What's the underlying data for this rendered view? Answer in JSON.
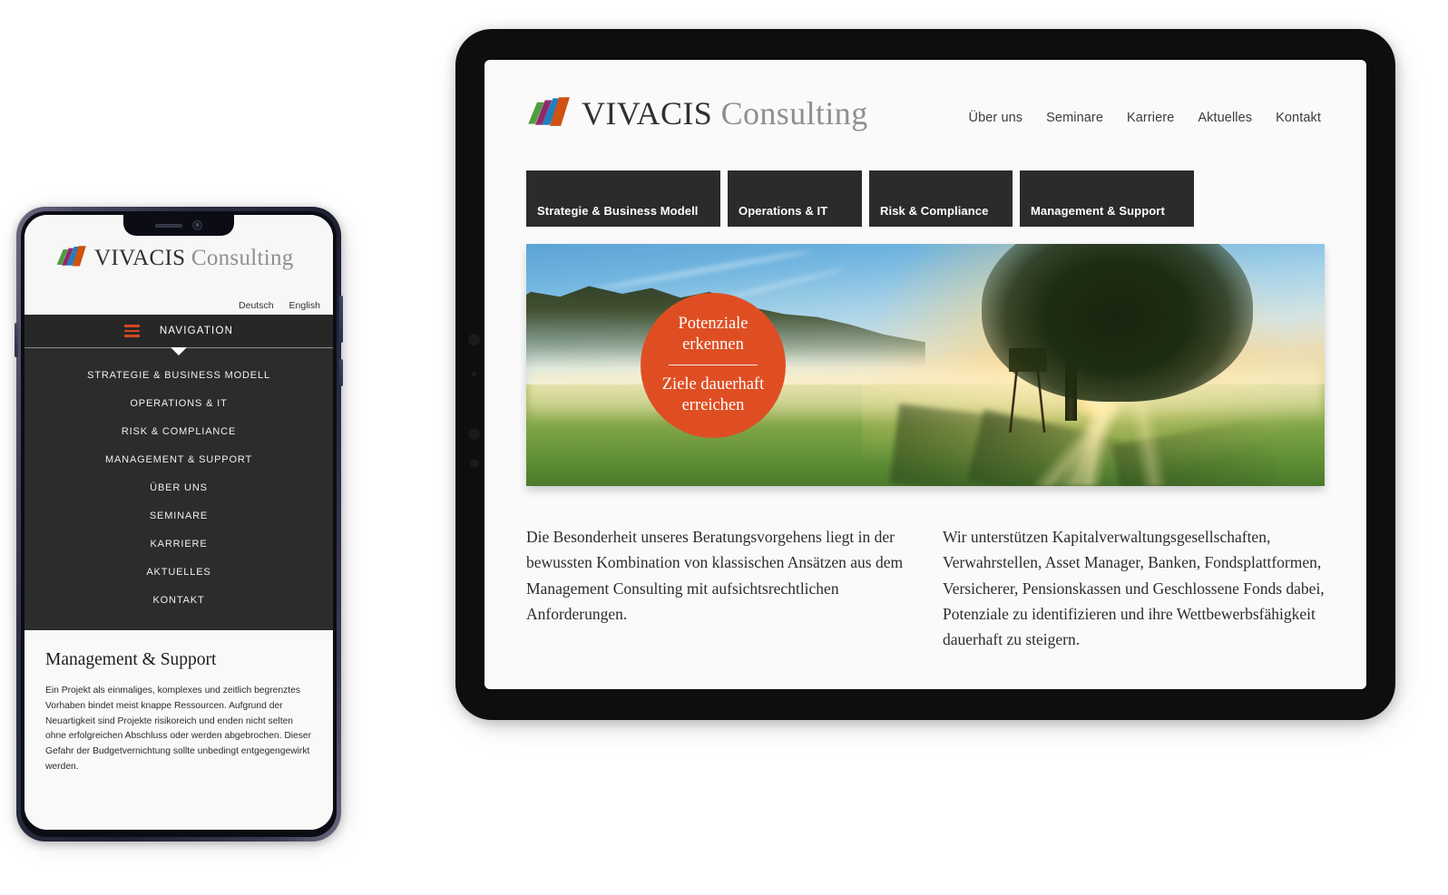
{
  "brand": {
    "name_bold": "VIVACIS",
    "name_light": "Consulting",
    "logo_colors": [
      "#4f9e3e",
      "#8e2a6b",
      "#1f7fc0",
      "#cf5212"
    ],
    "accent_orange": "#df4e23",
    "dark_bar": "#2b2b2b"
  },
  "phone": {
    "lang": {
      "de": "Deutsch",
      "en": "English"
    },
    "nav_toggle_label": "NAVIGATION",
    "menu_items": [
      "STRATEGIE & BUSINESS MODELL",
      "OPERATIONS & IT",
      "RISK & COMPLIANCE",
      "MANAGEMENT & SUPPORT",
      "ÜBER UNS",
      "SEMINARE",
      "KARRIERE",
      "AKTUELLES",
      "KONTAKT"
    ],
    "content": {
      "title": "Management & Support",
      "body": "Ein Projekt als einmaliges, komplexes und zeitlich begrenztes Vorhaben bindet meist knappe Ressourcen. Aufgrund der Neuartigkeit sind Projekte risikoreich und enden nicht selten ohne erfolgreichen Abschluss oder werden abgebrochen. Dieser Gefahr der Budgetvernichtung sollte unbedingt entgegengewirkt werden."
    }
  },
  "tablet": {
    "nav_links": [
      "Über uns",
      "Seminare",
      "Karriere",
      "Aktuelles",
      "Kontakt"
    ],
    "tabs": [
      "Strategie & Business Modell",
      "Operations & IT",
      "Risk & Compliance",
      "Management & Support"
    ],
    "hero": {
      "badge_top": "Potenziale\nerkennen",
      "badge_bottom": "Ziele dauerhaft\nerreichen",
      "badge_top_line1": "Potenziale",
      "badge_top_line2": "erkennen",
      "badge_bottom_line1": "Ziele dauerhaft",
      "badge_bottom_line2": "erreichen",
      "image_description": "sunrise-meadow-tree-photo"
    },
    "columns": {
      "left": "Die Besonderheit unseres Beratungsvorgehens liegt in der bewussten Kombination von klassischen Ansätzen aus dem Management Consulting mit aufsichtsrechtlichen Anforderungen.",
      "right": "Wir unterstützen Kapitalverwaltungsgesellschaften, Verwahrstellen, Asset Manager, Banken, Fondsplattformen, Versicherer, Pensionskassen und Geschlossene Fonds dabei, Potenziale zu identifizieren und ihre Wettbewerbsfähigkeit dauerhaft zu steigern."
    }
  }
}
